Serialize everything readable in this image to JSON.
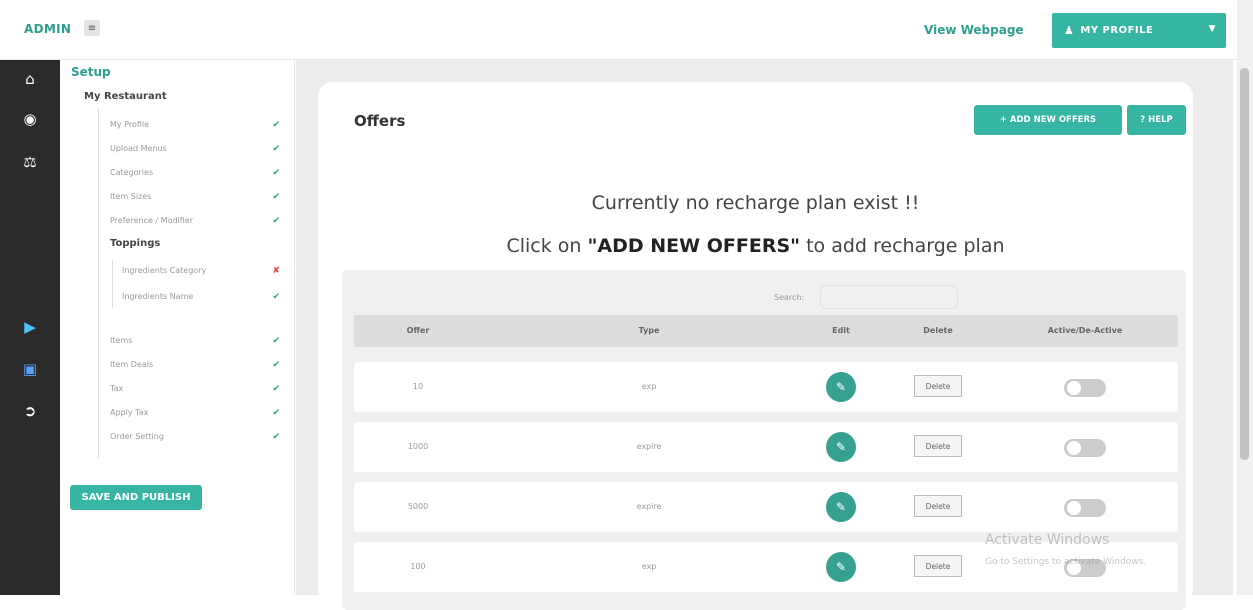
{
  "topbar": {
    "brand": "ADMIN",
    "menu_icon": "hamburger-icon",
    "view_webpage": "View Webpage",
    "profile_label": "MY PROFILE",
    "user_icon": "user-icon",
    "caret_icon": "chevron-down-icon"
  },
  "iconbar": {
    "items": [
      "home-icon",
      "cube-icon",
      "restaurant-icon",
      "play-store-icon",
      "app-store-icon",
      "logout-icon"
    ]
  },
  "sidebar": {
    "setup": "Setup",
    "section": "My Restaurant",
    "items": [
      {
        "label": "My Profile",
        "status": "done"
      },
      {
        "label": "Upload Menus",
        "status": "done"
      },
      {
        "label": "Categories",
        "status": "done"
      },
      {
        "label": "Item Sizes",
        "status": "done"
      },
      {
        "label": "Preference / Modifier",
        "status": "done"
      }
    ],
    "toppings": "Toppings",
    "toppings_items": [
      {
        "label": "Ingredients Category",
        "status": "missing"
      },
      {
        "label": "Ingredients Name",
        "status": "done"
      }
    ],
    "items2": [
      {
        "label": "Items",
        "status": "done"
      },
      {
        "label": "Item Deals",
        "status": "done"
      },
      {
        "label": "Tax",
        "status": "done"
      },
      {
        "label": "Apply Tax",
        "status": "done"
      },
      {
        "label": "Order Setting",
        "status": "done"
      }
    ],
    "check_mark": "✔",
    "cross_mark": "✘",
    "save_label": "SAVE AND PUBLISH"
  },
  "main": {
    "title": "Offers",
    "add_label": "+ ADD NEW OFFERS",
    "help_label": "? HELP",
    "msg_line1": "Currently no recharge plan exist !!",
    "msg_line2_prefix": "Click on ",
    "msg_line2_bold": "\"ADD NEW OFFERS\"",
    "msg_line2_suffix": " to add recharge plan",
    "search_label": "Search:",
    "search_value": "",
    "columns": [
      "Offer",
      "Type",
      "Edit",
      "Delete",
      "Active/De-Active"
    ],
    "rows": [
      {
        "offer": "10",
        "type": "exp",
        "active": false
      },
      {
        "offer": "1000",
        "type": "expire",
        "active": false
      },
      {
        "offer": "5000",
        "type": "expire",
        "active": false
      },
      {
        "offer": "100",
        "type": "exp",
        "active": false
      }
    ],
    "delete_label": "Delete",
    "edit_icon": "pencil-icon"
  },
  "watermark": {
    "line1": "Activate Windows",
    "line2": "Go to Settings to activate Windows."
  },
  "colors": {
    "accent": "#36b5a2",
    "sidebar_dark": "#2b2b2b",
    "content_bg": "#ececec"
  }
}
